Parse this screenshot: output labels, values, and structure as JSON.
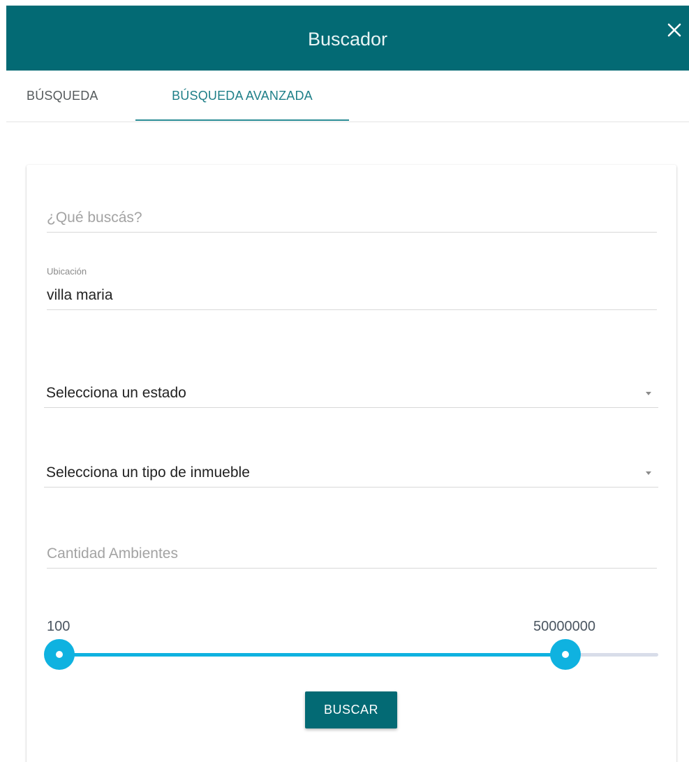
{
  "header": {
    "title": "Buscador",
    "close_icon": "close-icon",
    "background_color": "#036a74"
  },
  "tabs": [
    {
      "label": "BÚSQUEDA",
      "active": false
    },
    {
      "label": "BÚSQUEDA AVANZADA",
      "active": true
    }
  ],
  "form": {
    "query": {
      "placeholder": "¿Qué buscás?",
      "value": ""
    },
    "ubicacion": {
      "label": "Ubicación",
      "value": "villa maria"
    },
    "estado": {
      "selected": "Selecciona un estado"
    },
    "tipo_inmueble": {
      "selected": "Selecciona un tipo de inmueble"
    },
    "ambientes": {
      "placeholder": "Cantidad Ambientes",
      "value": ""
    },
    "price_range": {
      "min_label": "100",
      "max_label": "50000000",
      "low_fraction": 0.0,
      "high_fraction": 0.845,
      "color": "#0fb2e0"
    },
    "submit_label": "BUSCAR"
  }
}
